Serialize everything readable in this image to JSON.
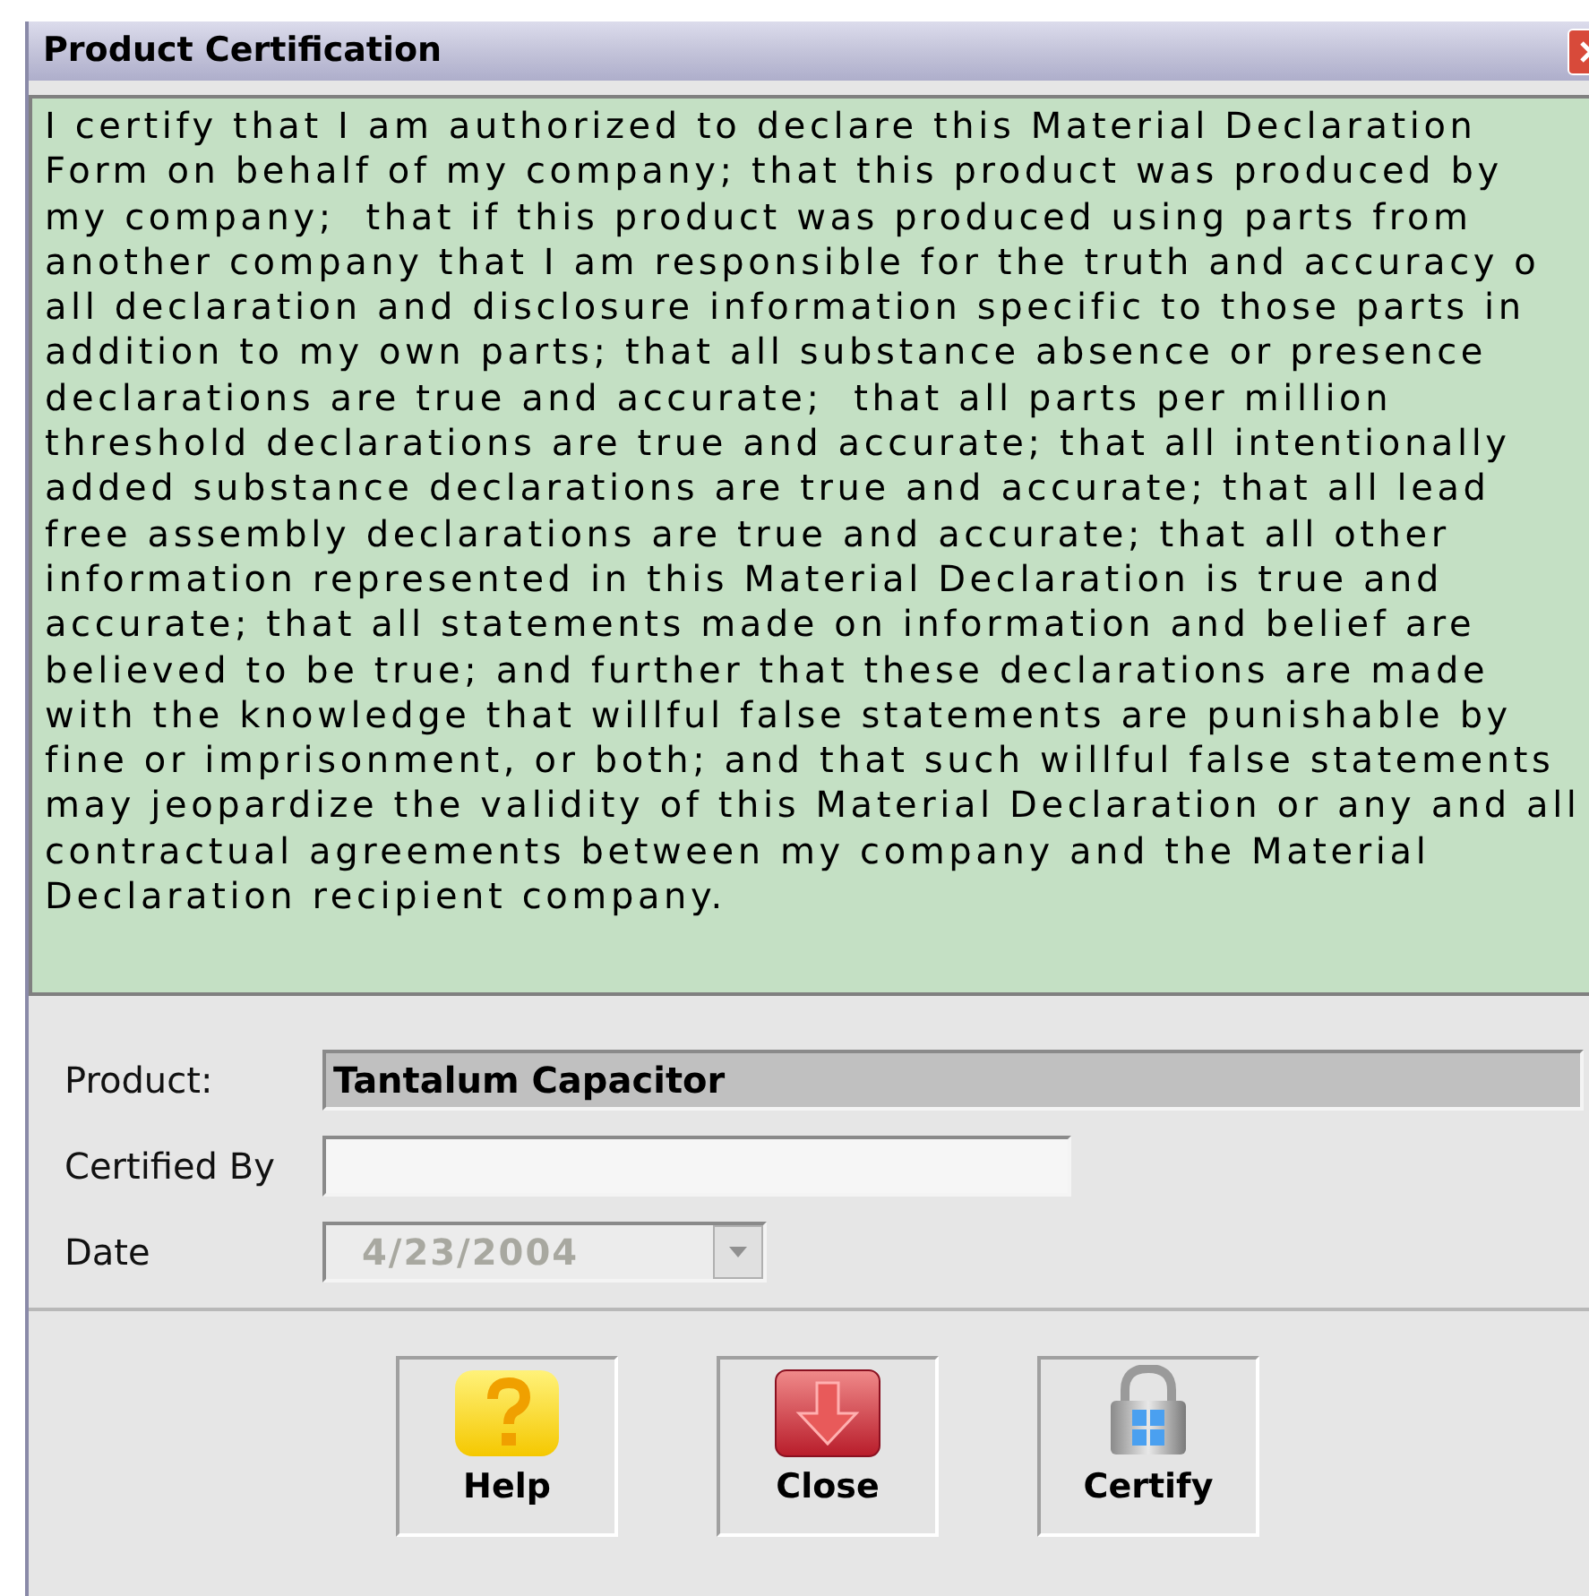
{
  "window": {
    "title": "Product Certification"
  },
  "statement": {
    "lines": [
      "I certify that I am authorized to declare this Material Declaration",
      "Form on behalf of my company; that this product was produced by",
      "my company;  that if this product was produced using parts from",
      "another company that I am responsible for the truth and accuracy o",
      "all declaration and disclosure information specific to those parts in",
      "addition to my own parts; that all substance absence or presence",
      "declarations are true and accurate;  that all parts per million",
      "threshold declarations are true and accurate; that all intentionally",
      "added substance declarations are true and accurate; that all lead",
      "free assembly declarations are true and accurate; that all other",
      "information represented in this Material Declaration is true and",
      "accurate; that all statements made on information and belief are",
      "believed to be true; and further that these declarations are made",
      "with the knowledge that willful false statements are punishable by",
      "fine or imprisonment, or both; and that such willful false statements",
      "may jeopardize the validity of this Material Declaration or any and all",
      "contractual agreements between my company and the Material",
      "Declaration recipient company."
    ]
  },
  "fields": [
    {
      "label": "Product:",
      "kind": "readonly",
      "value": "Tantalum Capacitor"
    },
    {
      "label": "Certified By",
      "kind": "text"
    },
    {
      "label": "Date",
      "kind": "date",
      "value": "4/23/2004",
      "disabled": true
    }
  ],
  "buttons": [
    {
      "label": "Help",
      "kind": "help"
    },
    {
      "label": "Close",
      "kind": "close"
    },
    {
      "label": "Certify",
      "kind": "certify"
    }
  ]
}
